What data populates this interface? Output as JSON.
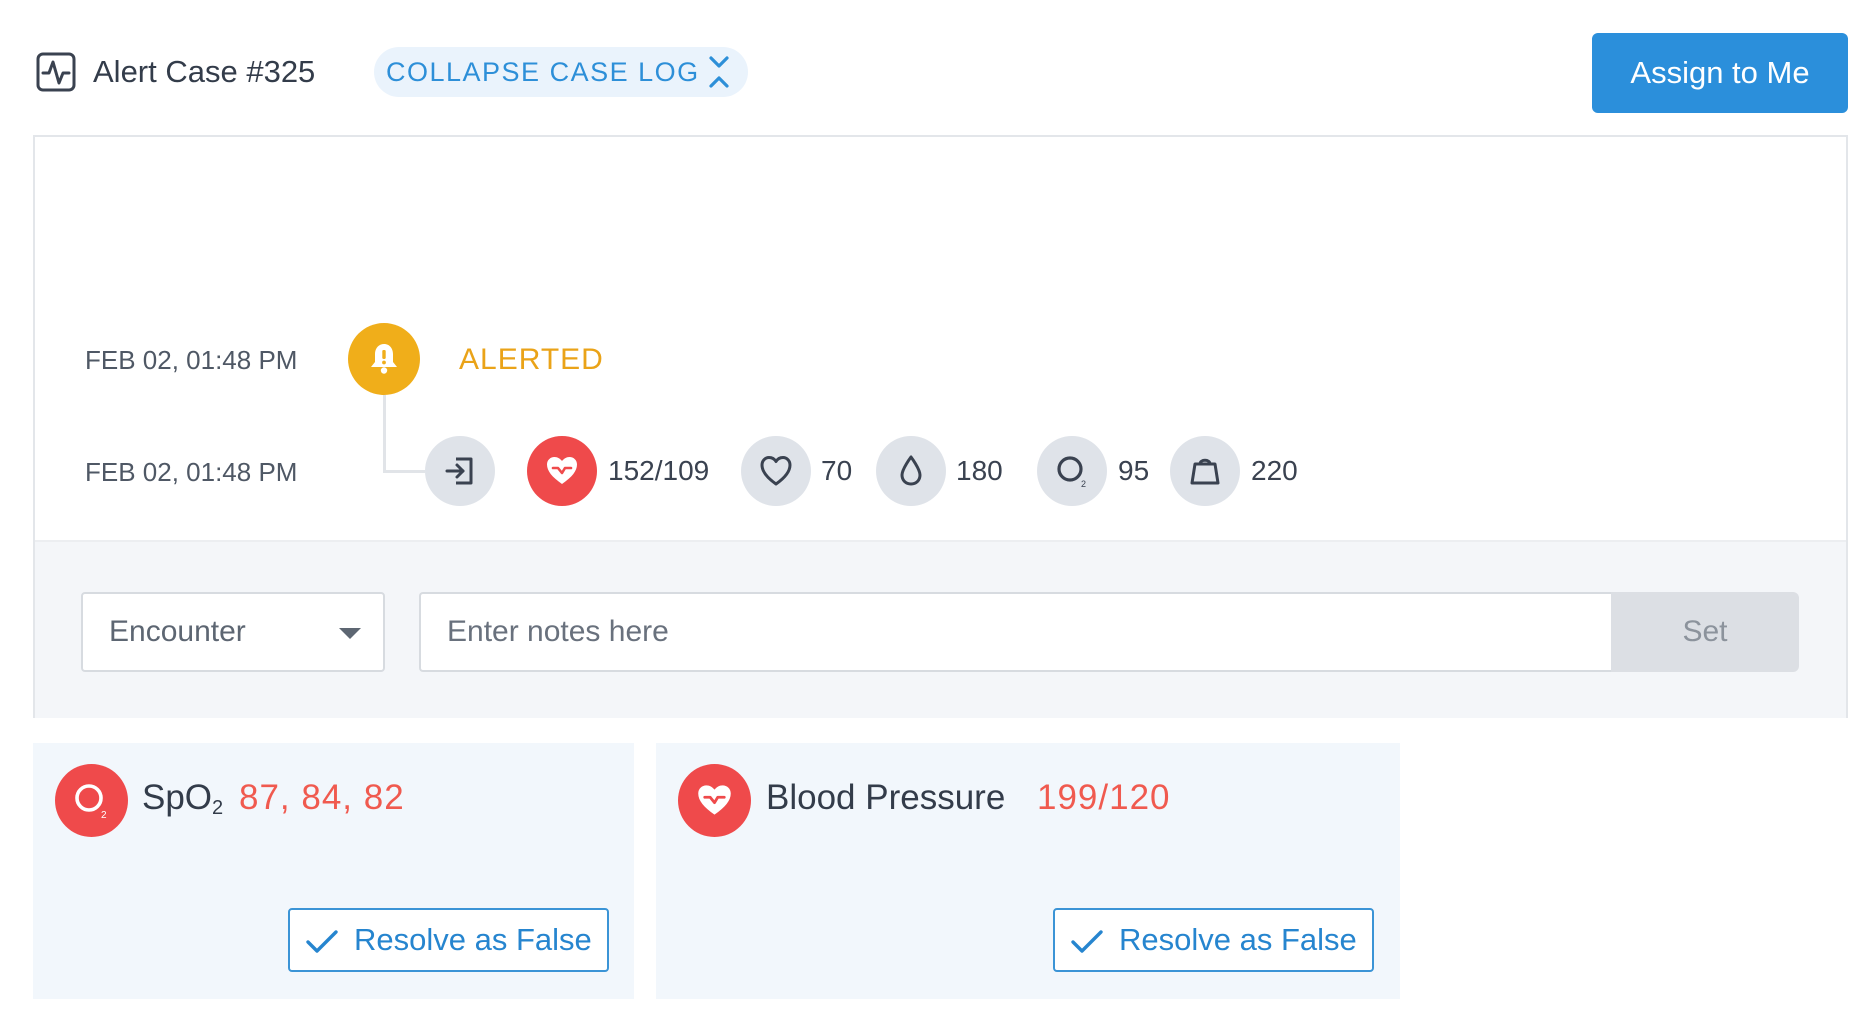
{
  "header": {
    "icon": "activity-monitor-icon",
    "case_title": "Alert Case #325",
    "collapse_label": "COLLAPSE CASE LOG",
    "collapse_icon": "collapse-chevrons-icon",
    "assign_label": "Assign to Me"
  },
  "case_log": {
    "events": [
      {
        "timestamp": "FEB 02, 01:48 PM",
        "icon": "bell-alert-icon",
        "label": "ALERTED",
        "color": "#f0ae1a"
      },
      {
        "timestamp": "FEB 02, 01:48 PM",
        "icon": "entry-arrow-icon",
        "vitals": [
          {
            "icon": "heart-filled-icon",
            "value": "152/109",
            "highlight": true
          },
          {
            "icon": "heart-outline-icon",
            "value": "70"
          },
          {
            "icon": "drop-icon",
            "value": "180"
          },
          {
            "icon": "oxygen-icon",
            "value": "95"
          },
          {
            "icon": "weight-icon",
            "value": "220"
          }
        ]
      }
    ],
    "notes": {
      "type_select_value": "Encounter",
      "notes_placeholder": "Enter notes here",
      "set_label": "Set"
    }
  },
  "alerts": [
    {
      "icon": "oxygen-icon",
      "name": "SpO",
      "name_subscript": "2",
      "values": "87, 84, 82",
      "resolve_label": "Resolve as False"
    },
    {
      "icon": "heart-filled-icon",
      "name": "Blood Pressure",
      "values": "199/120",
      "resolve_label": "Resolve as False"
    }
  ],
  "colors": {
    "accent": "#2b8fdb",
    "alert_red": "#ef4a4b",
    "alert_amber": "#f0ae1a",
    "value_red": "#f05a4f"
  }
}
